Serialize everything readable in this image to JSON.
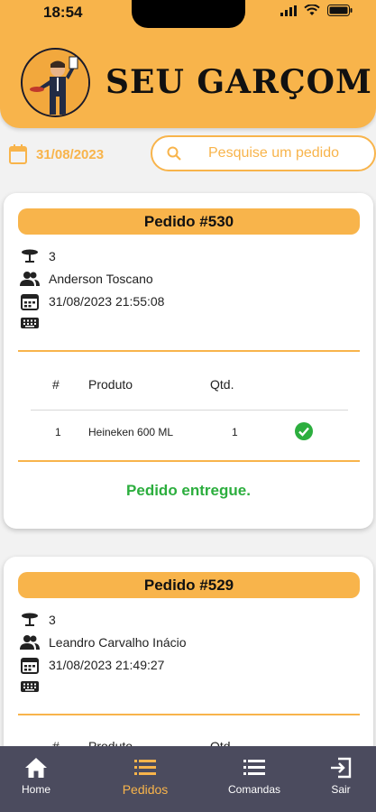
{
  "status_bar": {
    "time": "18:54"
  },
  "header": {
    "title": "SEU GARÇOM"
  },
  "filters": {
    "date": "31/08/2023",
    "search_placeholder": "Pesquise um pedido"
  },
  "orders": [
    {
      "title": "Pedido #530",
      "table": "3",
      "customer": "Anderson Toscano",
      "datetime": "31/08/2023 21:55:08",
      "columns": [
        "#",
        "Produto",
        "Qtd."
      ],
      "items": [
        {
          "num": "1",
          "product": "Heineken 600 ML",
          "qty": "1"
        }
      ],
      "status": "Pedido entregue."
    },
    {
      "title": "Pedido #529",
      "table": "3",
      "customer": "Leandro Carvalho Inácio",
      "datetime": "31/08/2023 21:49:27",
      "columns": [
        "#",
        "Produto",
        "Qtd."
      ]
    }
  ],
  "tabs": [
    {
      "label": "Home",
      "icon": "home-icon"
    },
    {
      "label": "Pedidos",
      "icon": "list-icon"
    },
    {
      "label": "Comandas",
      "icon": "list-icon"
    },
    {
      "label": "Sair",
      "icon": "exit-icon"
    }
  ],
  "colors": {
    "accent": "#f8b44b",
    "tabbar": "#4b4b5e",
    "success": "#2cae3e"
  }
}
